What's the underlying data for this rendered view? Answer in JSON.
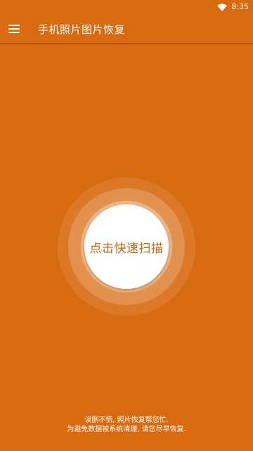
{
  "status_bar": {
    "time": "8:35",
    "wifi_icon": "wifi-icon"
  },
  "app_bar": {
    "menu_icon": "menu-icon",
    "title": "手机照片图片恢复"
  },
  "scan": {
    "button_label": "点击快速扫描"
  },
  "footer": {
    "line1": "误删不慌, 照片恢复帮您忙.",
    "line2": "为避免数据被系统清理, 请您尽早恢复."
  },
  "colors": {
    "background": "#D86A10",
    "button_text": "#C8620E",
    "button_bg": "#FFFFFF"
  }
}
